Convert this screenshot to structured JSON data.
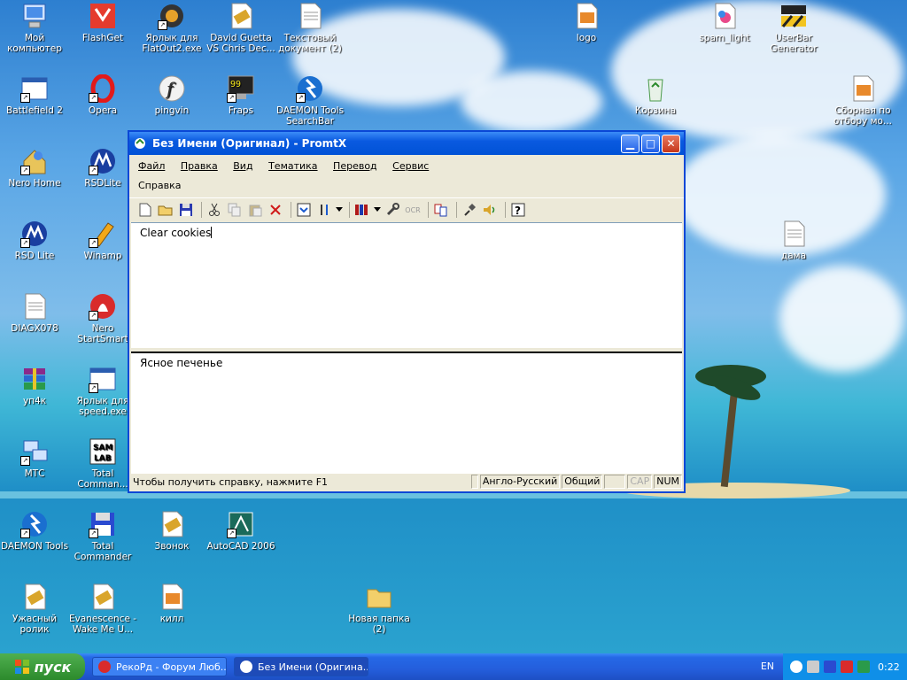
{
  "desktop_icons": [
    {
      "label": "Мой компьютер"
    },
    {
      "label": "FlashGet"
    },
    {
      "label": "Ярлык для FlatOut2.exe"
    },
    {
      "label": "David Guetta VS Chris Dec..."
    },
    {
      "label": "Текстовый документ (2)"
    },
    {
      "label": "logo"
    },
    {
      "label": "spam_light"
    },
    {
      "label": "UserBar Generator"
    },
    {
      "label": "Battlefield 2"
    },
    {
      "label": "Opera"
    },
    {
      "label": "pingvin"
    },
    {
      "label": "Fraps"
    },
    {
      "label": "DAEMON Tools SearchBar"
    },
    {
      "label": "Корзина"
    },
    {
      "label": "Сборная по отбору мо..."
    },
    {
      "label": "Nero Home"
    },
    {
      "label": "RSDLite"
    },
    {
      "label": "RSD Lite"
    },
    {
      "label": "Winamp"
    },
    {
      "label": "дама"
    },
    {
      "label": "DIAGX078"
    },
    {
      "label": "Nero StartSmart"
    },
    {
      "label": "уп4к"
    },
    {
      "label": "Ярлык для speed.exe"
    },
    {
      "label": "МТС"
    },
    {
      "label": "Total Comman..."
    },
    {
      "label": "DAEMON Tools"
    },
    {
      "label": "Total Commander"
    },
    {
      "label": "Звонок"
    },
    {
      "label": "AutoCAD 2006"
    },
    {
      "label": "Ужасный ролик"
    },
    {
      "label": "Evanescence - Wake Me U..."
    },
    {
      "label": "килл"
    },
    {
      "label": "Новая папка (2)"
    }
  ],
  "window": {
    "title": "Без Имени (Оригинал) - PromtX",
    "menu": [
      "Файл",
      "Правка",
      "Вид",
      "Тематика",
      "Перевод",
      "Сервис",
      "Справка"
    ],
    "source_text": "Clear cookies",
    "translation_text": "Ясное печенье",
    "status": {
      "hint": "Чтобы получить справку, нажмите F1",
      "direction": "Англо-Русский",
      "subject": "Общий",
      "cap": "CAP",
      "num": "NUM"
    }
  },
  "taskbar": {
    "start_label": "пуск",
    "tasks": [
      {
        "label": "РекоРд - Форум Люб..."
      },
      {
        "label": "Без Имени (Оригина..."
      }
    ],
    "lang": "EN",
    "clock": "0:22"
  },
  "colors": {
    "titlebar": "#0a5ae0",
    "taskbar": "#245edc",
    "start": "#3c9a3c",
    "tray": "#0f8fe8"
  }
}
